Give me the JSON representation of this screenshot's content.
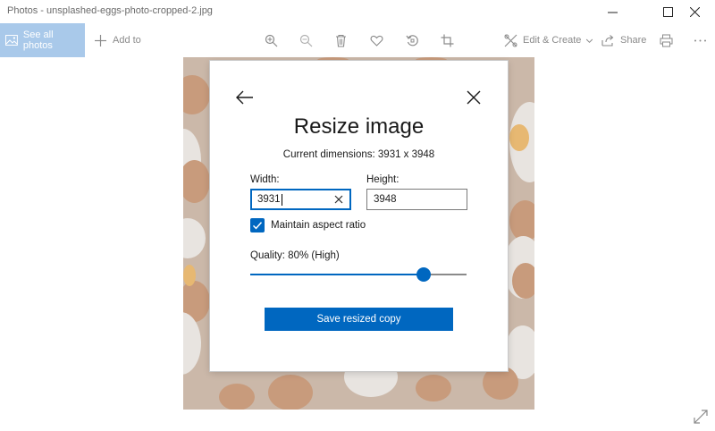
{
  "window": {
    "title": "Photos - unsplashed-eggs-photo-cropped-2.jpg"
  },
  "toolbar": {
    "see_all_label": "See all photos",
    "add_to_label": "Add to",
    "edit_create_label": "Edit & Create",
    "share_label": "Share",
    "icons": [
      "zoom-in-icon",
      "zoom-out-icon",
      "delete-icon",
      "heart-icon",
      "rotate-icon",
      "crop-icon",
      "edit-icon",
      "share-icon",
      "print-icon",
      "more-icon"
    ]
  },
  "dialog": {
    "title": "Resize image",
    "current_dimensions": "Current dimensions: 3931 x 3948",
    "width_label": "Width:",
    "width_value": "3931",
    "height_label": "Height:",
    "height_value": "3948",
    "maintain_aspect_label": "Maintain aspect ratio",
    "maintain_aspect_checked": true,
    "quality_label": "Quality: 80% (High)",
    "quality_value": 0.8,
    "save_button_label": "Save resized copy"
  },
  "colors": {
    "accent": "#0067c0",
    "see_all_bg": "#a9c9ea",
    "photo_bg": "#cbb8a9"
  }
}
